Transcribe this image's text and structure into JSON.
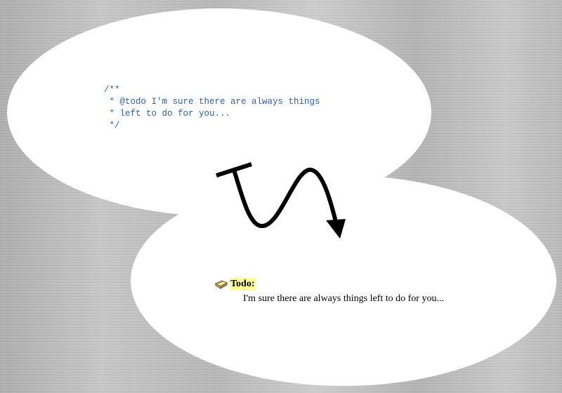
{
  "source_bubble": {
    "code_lines": [
      "/**",
      " * @todo I'm sure there are always things",
      " * left to do for you...",
      " */"
    ]
  },
  "transform_arrow": {
    "icon": "wavy-arrow-icon",
    "color": "#000000"
  },
  "output_bubble": {
    "icon": "note-book-icon",
    "label": "Todo:",
    "label_highlight": "#ffff99",
    "text": "I'm sure there are always things left to do for you..."
  },
  "colors": {
    "code_text": "#2f5fa8",
    "bubble_fill": "#ffffff",
    "background": "#bdbdbd"
  }
}
